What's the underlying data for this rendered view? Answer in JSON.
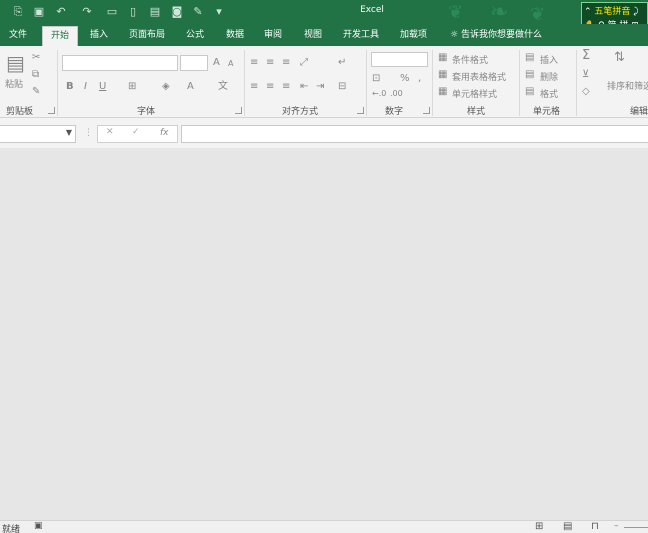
{
  "window": {
    "title": "Excel"
  },
  "ime": {
    "name": "五笔拼音",
    "status": "简 拼"
  },
  "tabs": [
    {
      "label": "文件"
    },
    {
      "label": "开始"
    },
    {
      "label": "插入"
    },
    {
      "label": "页面布局"
    },
    {
      "label": "公式"
    },
    {
      "label": "数据"
    },
    {
      "label": "审阅"
    },
    {
      "label": "视图"
    },
    {
      "label": "开发工具"
    },
    {
      "label": "加载项"
    }
  ],
  "tell_me": "告诉我你想要做什么",
  "ribbon": {
    "clipboard": {
      "paste": "粘贴",
      "label": "剪贴板"
    },
    "font": {
      "bold": "B",
      "italic": "I",
      "underline": "U",
      "font_color": "A",
      "grow": "A",
      "shrink": "A",
      "label": "字体"
    },
    "alignment": {
      "label": "对齐方式"
    },
    "number": {
      "percent": "%",
      "comma": ",",
      "label": "数字"
    },
    "styles": {
      "conditional": "条件格式",
      "table": "套用表格格式",
      "cell_styles": "单元格样式",
      "label": "样式"
    },
    "cells": {
      "insert": "插入",
      "delete": "删除",
      "format": "格式",
      "label": "单元格"
    },
    "editing": {
      "sort": "排序和筛选",
      "label": "编辑"
    }
  },
  "formula_bar": {
    "fx": "fx",
    "name_box": "",
    "formula": ""
  },
  "status": {
    "ready": "就绪"
  },
  "accent": "#217346"
}
